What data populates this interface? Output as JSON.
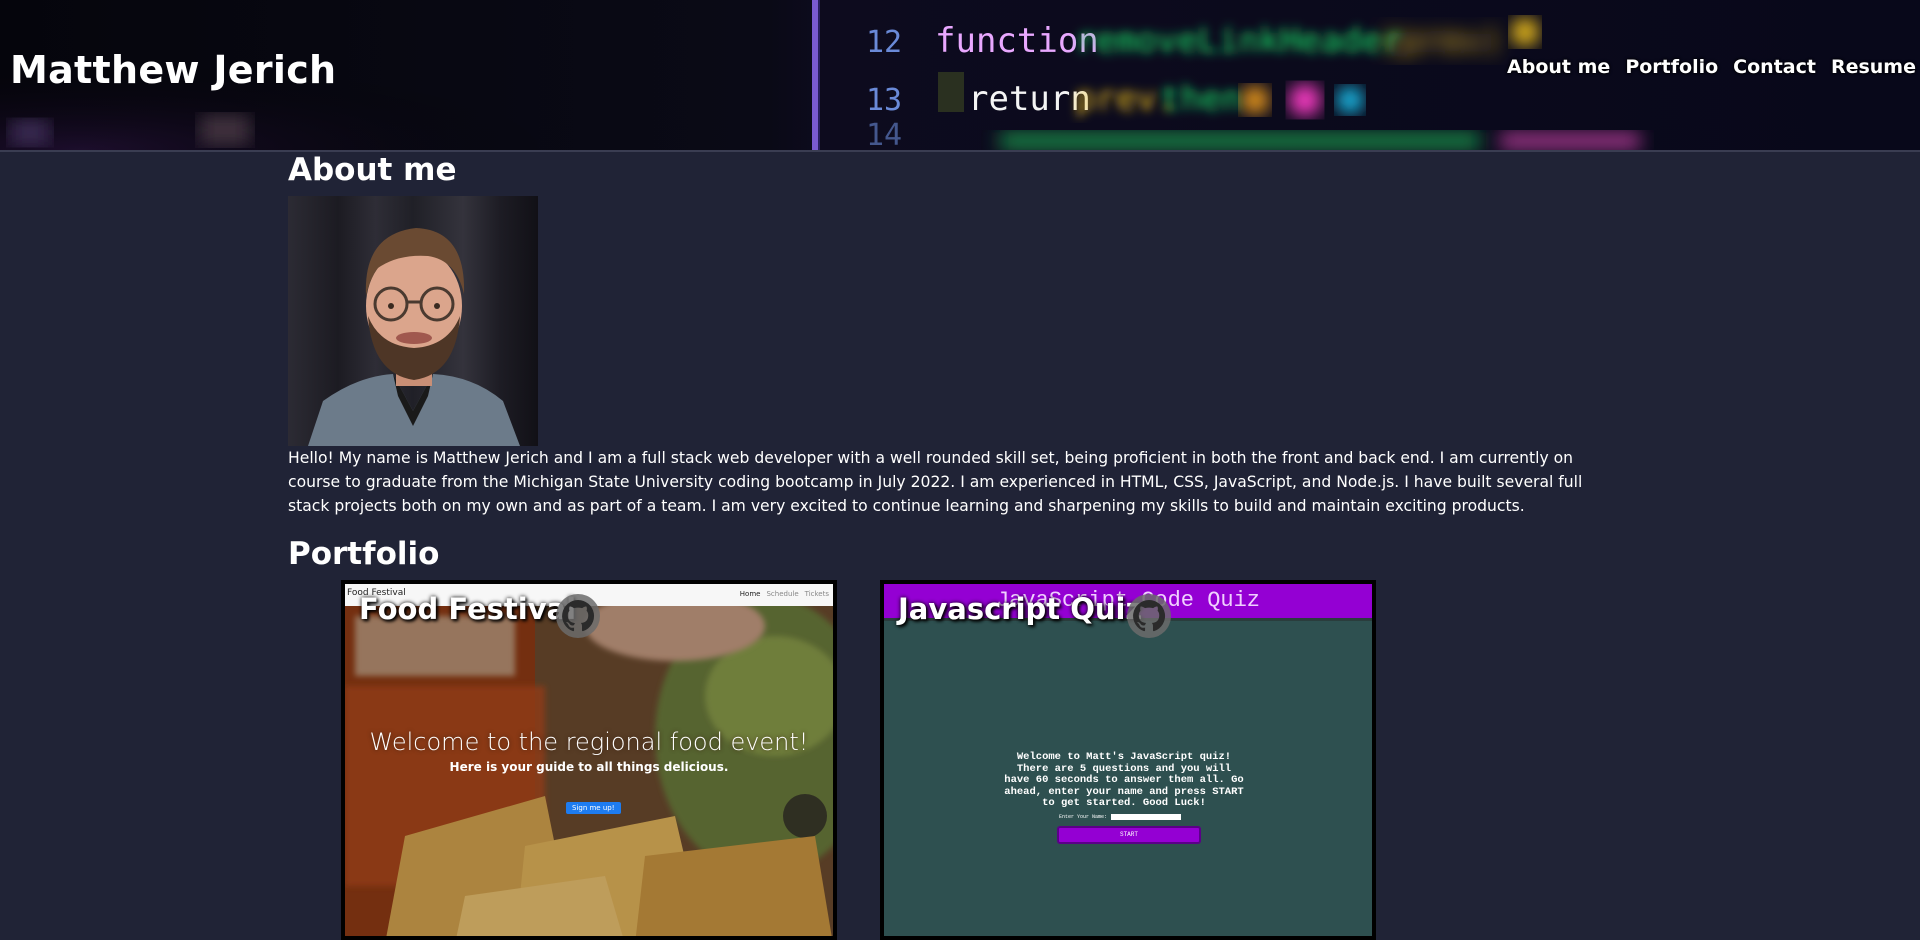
{
  "header": {
    "title": "Matthew Jerich",
    "code_lines": [
      {
        "num": "12",
        "code": "function removeLinkHeader(prev) {"
      },
      {
        "num": "13",
        "code": "return prev.then(r => {"
      }
    ]
  },
  "nav": {
    "items": [
      {
        "label": "About me"
      },
      {
        "label": "Portfolio"
      },
      {
        "label": "Contact"
      },
      {
        "label": "Resume"
      }
    ]
  },
  "about": {
    "heading": "About me",
    "bio": "Hello! My name is Matthew Jerich and I am a full stack web developer with a well rounded skill set, being proficient in both the front and back end. I am currently on course to graduate from the Michigan State University coding bootcamp in July 2022. I am experienced in HTML, CSS, JavaScript, and Node.js. I have built several full stack projects both on my own and as part of a team. I am very excited to continue learning and sharpening my skills to build and maintain exciting products."
  },
  "portfolio": {
    "heading": "Portfolio",
    "projects": [
      {
        "title": "Food Festival",
        "icon": "github-icon",
        "preview": {
          "brand": "Food Festival",
          "links": [
            "Home",
            "Schedule",
            "Tickets"
          ],
          "headline": "Welcome to the regional food event!",
          "subhead": "Here is your guide to all things delicious.",
          "button": "Sign me up!"
        }
      },
      {
        "title": "Javascript Quiz",
        "icon": "github-icon",
        "preview": {
          "heading": "JavaScript Code Quiz",
          "intro": "Welcome to Matt's JavaScript quiz! There are 5 questions and you will have 60 seconds to answer them all. Go ahead, enter your name and press START to get started. Good Luck!",
          "name_label": "Enter Your Name:",
          "button": "START"
        }
      }
    ]
  },
  "colors": {
    "page_bg": "#202336",
    "text": "#ffffff",
    "quiz_purple": "#9400d3",
    "quiz_bg": "#2e5050"
  }
}
